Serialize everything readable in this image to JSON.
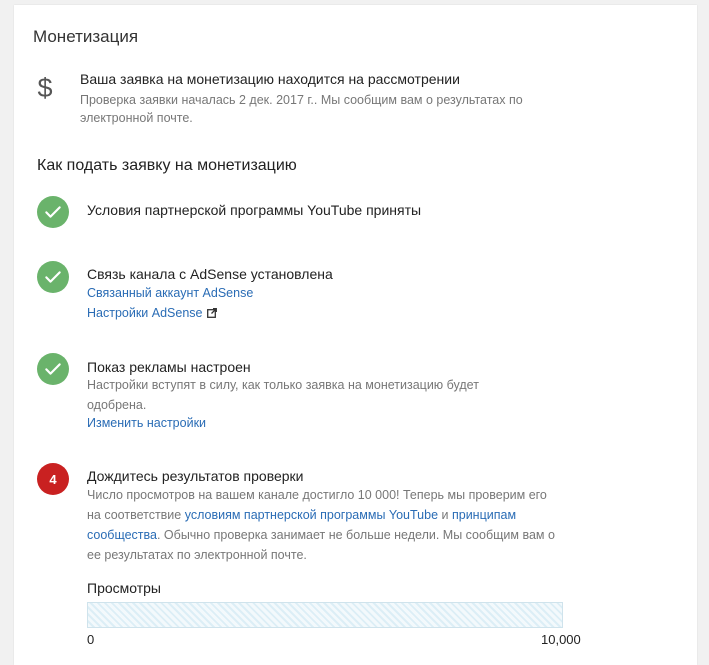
{
  "page": {
    "title": "Монетизация"
  },
  "status": {
    "icon": "dollar-icon",
    "heading": "Ваша заявка на монетизацию находится на рассмотрении",
    "subtext": "Проверка заявки началась 2 дек. 2017 г.. Мы сообщим вам о результатах по электронной почте."
  },
  "how_to": {
    "title": "Как подать заявку на монетизацию",
    "steps": [
      {
        "status": "done",
        "icon": "checkmark-icon",
        "title": "Условия партнерской программы YouTube приняты"
      },
      {
        "status": "done",
        "icon": "checkmark-icon",
        "title": "Связь канала с AdSense установлена",
        "links": [
          "Связанный аккаунт AdSense",
          "Настройки AdSense"
        ]
      },
      {
        "status": "done",
        "icon": "checkmark-icon",
        "title": "Показ рекламы настроен",
        "text": "Настройки вступят в силу, как только заявка на монетизацию будет одобрена.",
        "link": "Изменить настройки"
      },
      {
        "status": "pending",
        "number": "4",
        "title": "Дождитесь результатов проверки",
        "text_part1": "Число просмотров на вашем канале достигло 10 000! Теперь мы проверим его на соответствие ",
        "link1": "условиям партнерской программы YouTube",
        "text_part2": " и ",
        "link2": "принципам сообщества",
        "text_part3": ". Обычно проверка занимает не больше недели. Мы сообщим вам о ее результатах по электронной почте."
      }
    ]
  },
  "views_progress": {
    "label": "Просмотры",
    "min_label": "0",
    "max_label": "10,000",
    "fraction": 0
  },
  "colors": {
    "done": "#6ab36b",
    "pending": "#c92121",
    "link": "#2a6cb5"
  }
}
